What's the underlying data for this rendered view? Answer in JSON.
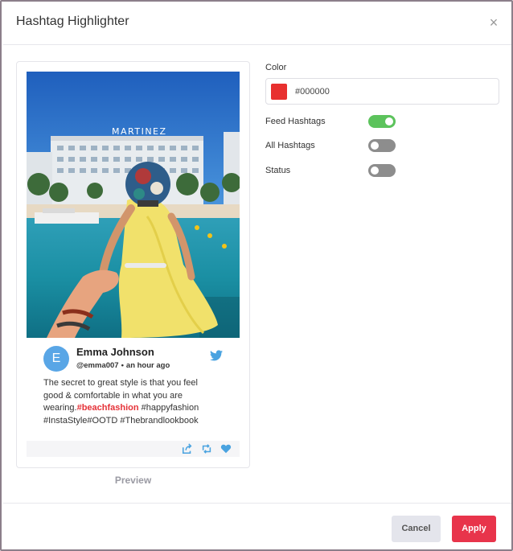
{
  "dialog": {
    "title": "Hashtag Highlighter",
    "close_symbol": "×"
  },
  "preview": {
    "sign_text": "MARTINEZ",
    "author": {
      "initial": "E",
      "name": "Emma Johnson",
      "handle": "@emma007",
      "dot": "•",
      "time": "an hour ago"
    },
    "tweet": {
      "line1": "The secret to great style is that you feel",
      "line2": "good & comfortable in what you are",
      "line3_prefix": "wearing.",
      "highlight": "#beachfashion",
      "line3_suffix": " #happyfashion",
      "line4": "#InstaStyle#OOTD #Thebrandlookbook"
    },
    "label": "Preview"
  },
  "settings": {
    "color_label": "Color",
    "color_value": "#000000",
    "swatch_color": "#e8302f",
    "rows": [
      {
        "label": "Feed Hashtags",
        "on": true
      },
      {
        "label": "All Hashtags",
        "on": false
      },
      {
        "label": "Status",
        "on": false
      }
    ]
  },
  "footer": {
    "cancel_label": "Cancel",
    "apply_label": "Apply"
  },
  "colors": {
    "accent": "#e8344b",
    "toggle_on": "#5cc35c",
    "toggle_off": "#8d8d8d",
    "hashtag": "#e53238",
    "twitter": "#4aa3e0"
  }
}
